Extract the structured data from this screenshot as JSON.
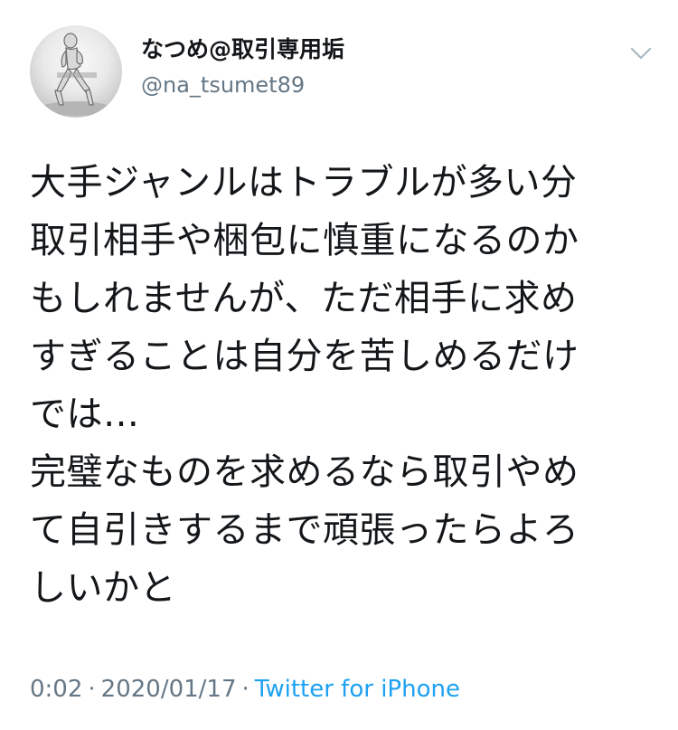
{
  "tweet": {
    "display_name": "なつめ@取引専用垢",
    "handle": "@na_tsumet89",
    "avatar_icon": "user-avatar-figure-icon",
    "menu_icon": "chevron-down-icon",
    "body_lines": [
      "大手ジャンルはトラブルが多い分",
      "取引相手や梱包に慎重になるのか",
      "もしれませんが、ただ相手に求め",
      "すぎることは自分を苦しめるだけ",
      "では…",
      "完璧なものを求めるなら取引やめ",
      "て自引きするまで頑張ったらよろ",
      "しいかと"
    ],
    "time": "0:02",
    "separator": "·",
    "date": "2020/01/17",
    "source": "Twitter for iPhone",
    "colors": {
      "text": "#14171a",
      "secondary": "#657786",
      "link": "#1da1f2",
      "chevron": "#aab8c2"
    }
  }
}
